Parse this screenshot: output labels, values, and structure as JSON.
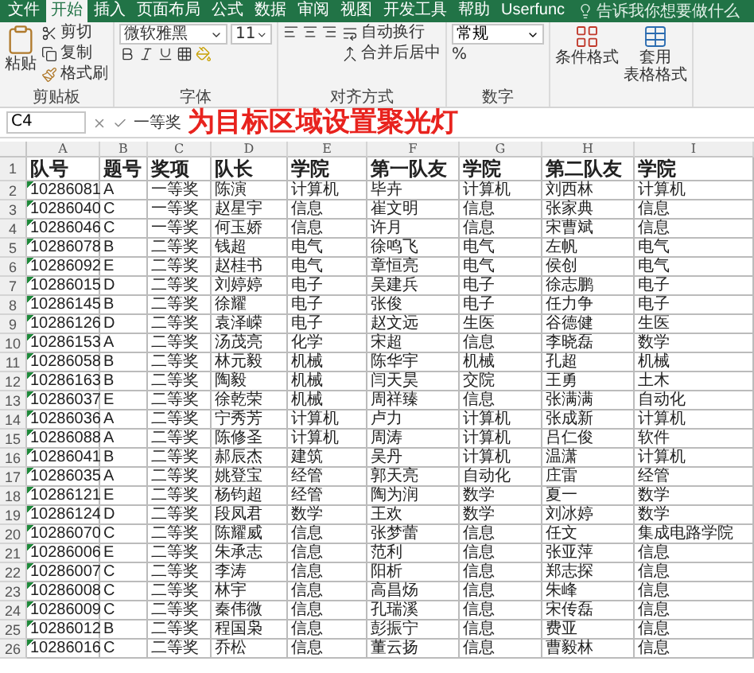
{
  "menu_tabs": [
    {
      "label": "文件",
      "selected": false
    },
    {
      "label": "开始",
      "selected": true
    },
    {
      "label": "插入",
      "selected": false
    },
    {
      "label": "页面布局",
      "selected": false
    },
    {
      "label": "公式",
      "selected": false
    },
    {
      "label": "数据",
      "selected": false
    },
    {
      "label": "审阅",
      "selected": false
    },
    {
      "label": "视图",
      "selected": false
    },
    {
      "label": "开发工具",
      "selected": false
    },
    {
      "label": "帮助",
      "selected": false
    },
    {
      "label": "Userfunc",
      "selected": false
    }
  ],
  "tell_me": {
    "placeholder": "告诉我你想要做什么"
  },
  "clipboard": {
    "label": "剪贴板",
    "paste": "粘贴",
    "cut": "剪切",
    "copy": "复制",
    "format_painter": "格式刷"
  },
  "font": {
    "label": "字体",
    "name": "微软雅黑",
    "size": "11"
  },
  "alignment": {
    "label": "对齐方式",
    "wrap": "自动换行",
    "merge": "合并后居中"
  },
  "number": {
    "label": "数字",
    "format": "常规",
    "percent": "%"
  },
  "styles": {
    "conditional": "条件格式",
    "table_line1": "套用",
    "table_line2": "表格格式"
  },
  "formula_bar": {
    "name_box": "C4",
    "value": "一等奖"
  },
  "caption": "为目标区域设置聚光灯",
  "columns": [
    "A",
    "B",
    "C",
    "D",
    "E",
    "F",
    "G",
    "H",
    "I"
  ],
  "rows": [
    {
      "num": "1",
      "cells": [
        "队号",
        "题号",
        "奖项",
        "队长",
        "学院",
        "第一队友",
        "学院",
        "第二队友",
        "学院"
      ]
    },
    {
      "num": "2",
      "cells": [
        "10286081",
        "A",
        "一等奖",
        "陈演",
        "计算机",
        "毕卉",
        "计算机",
        "刘西林",
        "计算机"
      ]
    },
    {
      "num": "3",
      "cells": [
        "10286040",
        "C",
        "一等奖",
        "赵星宇",
        "信息",
        "崔文明",
        "信息",
        "张家典",
        "信息"
      ]
    },
    {
      "num": "4",
      "cells": [
        "10286046",
        "C",
        "一等奖",
        "何玉娇",
        "信息",
        "许月",
        "信息",
        "宋曹斌",
        "信息"
      ]
    },
    {
      "num": "5",
      "cells": [
        "10286078",
        "B",
        "二等奖",
        "钱超",
        "电气",
        "徐鸣飞",
        "电气",
        "左帆",
        "电气"
      ]
    },
    {
      "num": "6",
      "cells": [
        "10286092",
        "E",
        "二等奖",
        "赵桂书",
        "电气",
        "章恒亮",
        "电气",
        "侯创",
        "电气"
      ]
    },
    {
      "num": "7",
      "cells": [
        "10286015",
        "D",
        "二等奖",
        "刘婷婷",
        "电子",
        "吴建兵",
        "电子",
        "徐志鹏",
        "电子"
      ]
    },
    {
      "num": "8",
      "cells": [
        "10286145",
        "B",
        "二等奖",
        "徐耀",
        "电子",
        "张俊",
        "电子",
        "任力争",
        "电子"
      ]
    },
    {
      "num": "9",
      "cells": [
        "10286126",
        "D",
        "二等奖",
        "袁泽嵘",
        "电子",
        "赵文远",
        "生医",
        "谷德健",
        "生医"
      ]
    },
    {
      "num": "10",
      "cells": [
        "10286153",
        "A",
        "二等奖",
        "汤茂亮",
        "化学",
        "宋超",
        "信息",
        "李晓磊",
        "数学"
      ]
    },
    {
      "num": "11",
      "cells": [
        "10286058",
        "B",
        "二等奖",
        "林元毅",
        "机械",
        "陈华宇",
        "机械",
        "孔超",
        "机械"
      ]
    },
    {
      "num": "12",
      "cells": [
        "10286163",
        "B",
        "二等奖",
        "陶毅",
        "机械",
        "闫天昊",
        "交院",
        "王勇",
        "土木"
      ]
    },
    {
      "num": "13",
      "cells": [
        "10286037",
        "E",
        "二等奖",
        "徐乾荣",
        "机械",
        "周祥臻",
        "信息",
        "张满满",
        "自动化"
      ]
    },
    {
      "num": "14",
      "cells": [
        "10286036",
        "A",
        "二等奖",
        "宁秀芳",
        "计算机",
        "卢力",
        "计算机",
        "张成新",
        "计算机"
      ]
    },
    {
      "num": "15",
      "cells": [
        "10286088",
        "A",
        "二等奖",
        "陈修圣",
        "计算机",
        "周涛",
        "计算机",
        "吕仁俊",
        "软件"
      ]
    },
    {
      "num": "16",
      "cells": [
        "10286041",
        "B",
        "二等奖",
        "郝辰杰",
        "建筑",
        "吴丹",
        "计算机",
        "温潇",
        "计算机"
      ]
    },
    {
      "num": "17",
      "cells": [
        "10286035",
        "A",
        "二等奖",
        "姚登宝",
        "经管",
        "郭天亮",
        "自动化",
        "庄雷",
        "经管"
      ]
    },
    {
      "num": "18",
      "cells": [
        "10286121",
        "E",
        "二等奖",
        "杨钧超",
        "经管",
        "陶为润",
        "数学",
        "夏一",
        "数学"
      ]
    },
    {
      "num": "19",
      "cells": [
        "10286124",
        "D",
        "二等奖",
        "段凤君",
        "数学",
        "王欢",
        "数学",
        "刘冰婷",
        "数学"
      ]
    },
    {
      "num": "20",
      "cells": [
        "10286070",
        "C",
        "二等奖",
        "陈耀威",
        "信息",
        "张梦蕾",
        "信息",
        "任文",
        "集成电路学院"
      ]
    },
    {
      "num": "21",
      "cells": [
        "10286006",
        "E",
        "二等奖",
        "朱承志",
        "信息",
        "范利",
        "信息",
        "张亚萍",
        "信息"
      ]
    },
    {
      "num": "22",
      "cells": [
        "10286007",
        "C",
        "二等奖",
        "李涛",
        "信息",
        "阳析",
        "信息",
        "郑志探",
        "信息"
      ]
    },
    {
      "num": "23",
      "cells": [
        "10286008",
        "C",
        "二等奖",
        "林宇",
        "信息",
        "高昌炀",
        "信息",
        "朱峰",
        "信息"
      ]
    },
    {
      "num": "24",
      "cells": [
        "10286009",
        "C",
        "二等奖",
        "秦伟微",
        "信息",
        "孔瑞溪",
        "信息",
        "宋传磊",
        "信息"
      ]
    },
    {
      "num": "25",
      "cells": [
        "10286012",
        "B",
        "二等奖",
        "程国枭",
        "信息",
        "彭振宁",
        "信息",
        "费亚",
        "信息"
      ]
    },
    {
      "num": "26",
      "cells": [
        "10286016",
        "C",
        "二等奖",
        "乔松",
        "信息",
        "董云扬",
        "信息",
        "曹毅林",
        "信息"
      ]
    }
  ]
}
